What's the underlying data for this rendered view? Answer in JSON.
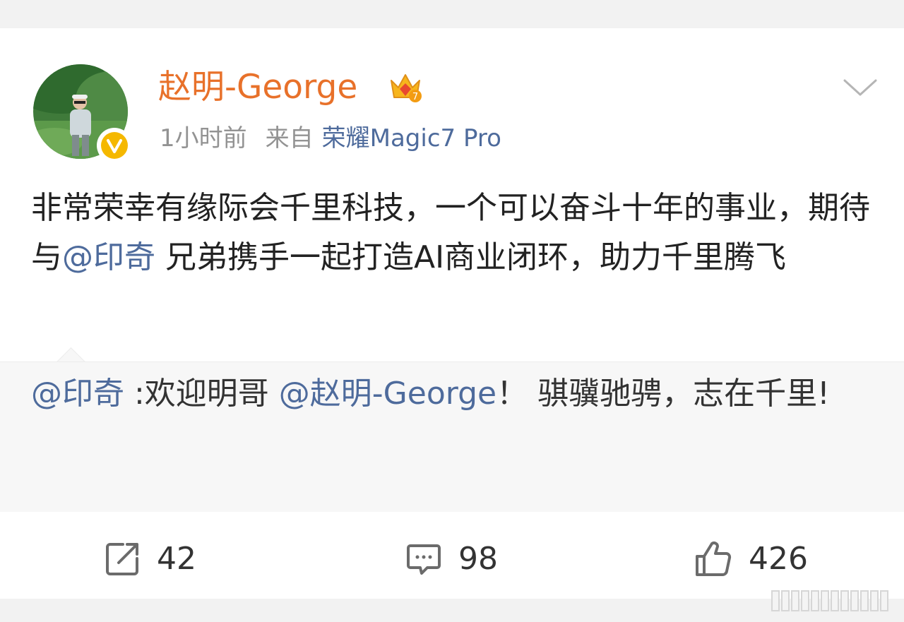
{
  "post": {
    "username": "赵明-George",
    "time": "1小时前",
    "source_prefix": "来自",
    "device": "荣耀Magic7 Pro",
    "content": {
      "part1": "非常荣幸有缘际会千里科技，一个可以奋斗十年的事业，期待与",
      "mention": "@印奇",
      "part2": " 兄弟携手一起打造AI商业闭环，助力千里腾飞"
    }
  },
  "retweet": {
    "author": "@印奇",
    "text1": " :欢迎明哥 ",
    "mention": "@赵明-George",
    "text2": "！  骐骥驰骋，志在千里!"
  },
  "actions": {
    "repost_count": "42",
    "comment_count": "98",
    "like_count": "426"
  },
  "colors": {
    "username": "#e8712a",
    "link": "#4e6b9c",
    "verified_badge": "#f5b800"
  }
}
